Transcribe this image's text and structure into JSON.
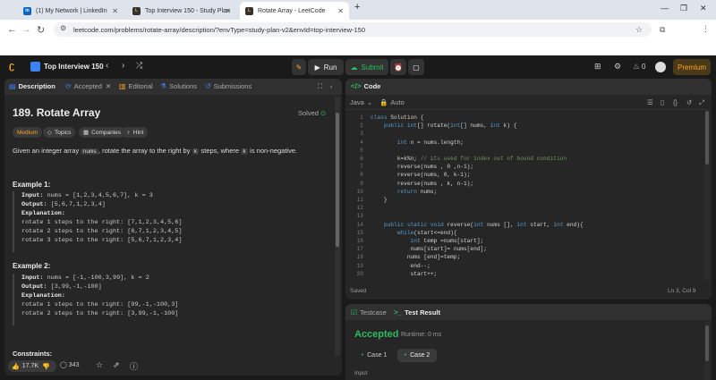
{
  "browser": {
    "tabs": [
      {
        "title": "(1) My Network | LinkedIn",
        "favicon": "linkedin-icon"
      },
      {
        "title": "Top Interview 150 - Study Plan",
        "favicon": "leetcode-icon"
      },
      {
        "title": "Rotate Array - LeetCode",
        "favicon": "leetcode-icon"
      }
    ],
    "new_tab": "+",
    "url": "leetcode.com/problems/rotate-array/description/?envType=study-plan-v2&envId=top-interview-150"
  },
  "nav": {
    "study_plan": "Top Interview 150",
    "run": "Run",
    "submit": "Submit",
    "streak": "0",
    "premium": "Premium"
  },
  "left": {
    "tabs": [
      "Description",
      "Accepted",
      "Editorial",
      "Solutions",
      "Submissions"
    ],
    "title": "189. Rotate Array",
    "solved": "Solved",
    "difficulty": "Medium",
    "tags": [
      "Topics",
      "Companies",
      "Hint"
    ],
    "desc_pre": "Given an integer array ",
    "desc_nums": "nums",
    "desc_mid": ", rotate the array to the right by ",
    "desc_k": "k",
    "desc_mid2": " steps, where ",
    "desc_k2": "k",
    "desc_end": " is non-negative.",
    "ex1_title": "Example 1:",
    "ex1_input_label": "Input:",
    "ex1_input": "nums = [1,2,3,4,5,6,7], k = 3",
    "ex1_output_label": "Output:",
    "ex1_output": "[5,6,7,1,2,3,4]",
    "ex1_expl_label": "Explanation:",
    "ex1_lines": [
      "rotate 1 steps to the right: [7,1,2,3,4,5,6]",
      "rotate 2 steps to the right: [6,7,1,2,3,4,5]",
      "rotate 3 steps to the right: [5,6,7,1,2,3,4]"
    ],
    "ex2_title": "Example 2:",
    "ex2_input_label": "Input:",
    "ex2_input": "nums = [-1,-100,3,99], k = 2",
    "ex2_output_label": "Output:",
    "ex2_output": "[3,99,-1,-100]",
    "ex2_expl_label": "Explanation:",
    "ex2_lines": [
      "rotate 1 steps to the right: [99,-1,-100,3]",
      "rotate 2 steps to the right: [3,99,-1,-100]"
    ],
    "constraints": "Constraints:",
    "likes": "17.7K",
    "comments": "343"
  },
  "code": {
    "title": "Code",
    "language": "Java",
    "auto": "Auto",
    "saved": "Saved",
    "position": "Ln 3, Col 9",
    "line_numbers": [
      "1",
      "2",
      "3",
      "4",
      "5",
      "6",
      "7",
      "8",
      "9",
      "10",
      "11",
      "12",
      "13",
      "14",
      "15",
      "16",
      "17",
      "18",
      "19",
      "20"
    ],
    "lines": [
      "class Solution {",
      "    public int[] rotate(int[] nums, int k) {",
      "",
      "        int n = nums.length;",
      "",
      "        k=k%n; // its used for index out of bound condition",
      "        reverse(nums , 0 ,n-1);",
      "        reverse(nums, 0, k-1);",
      "        reverse(nums , k, n-1);",
      "        return nums;",
      "    }",
      "",
      "",
      "    public static void reverse(int nums [], int start, int end){",
      "        while(start<=end){",
      "            int temp =nums[start];",
      "            nums[start]= nums[end];",
      "           nums [end]=temp;",
      "            end--;",
      "            start++;"
    ]
  },
  "testpanel": {
    "tab1": "Testcase",
    "tab2": "Test Result",
    "status": "Accepted",
    "runtime": "Runtime: 0 ms",
    "cases": [
      "Case 1",
      "Case 2"
    ],
    "input_label": "Input"
  }
}
